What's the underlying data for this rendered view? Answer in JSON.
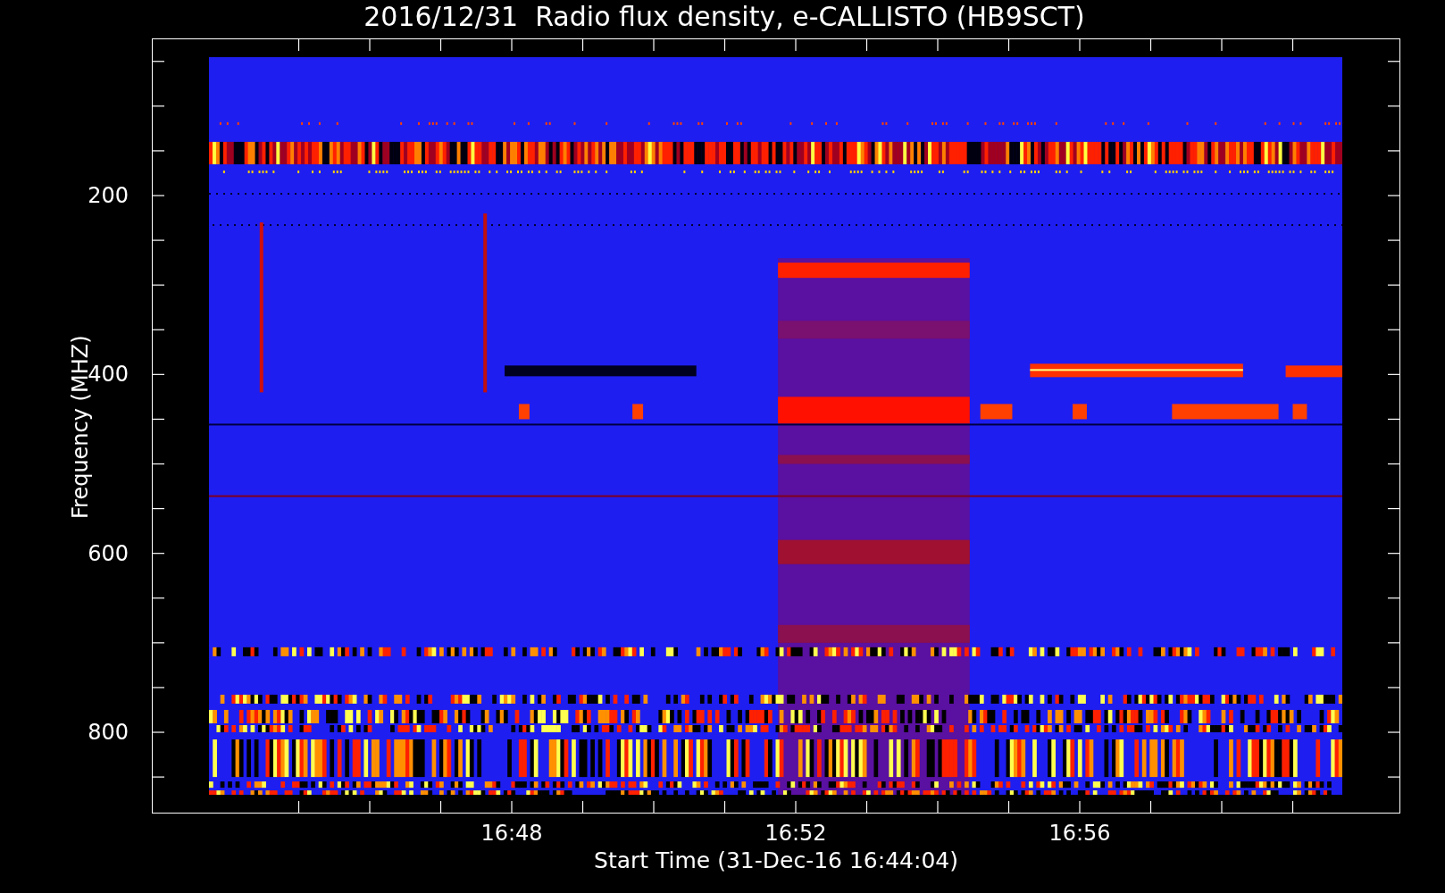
{
  "title": "2016/12/31  Radio flux density, e-CALLISTO (HB9SCT)",
  "plot": {
    "ylabel": "Frequency (MHZ)",
    "xlabel": "Start Time (31-Dec-16 16:44:04)",
    "yticks": [
      "200",
      "400",
      "600",
      "800"
    ],
    "xticks": [
      "16:48",
      "16:52",
      "16:56"
    ]
  }
}
